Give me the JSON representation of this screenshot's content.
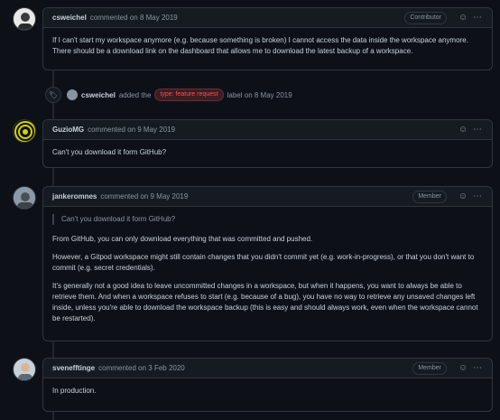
{
  "comments": [
    {
      "author": "csweichel",
      "meta": "commented on 8 May 2019",
      "badge": "Contributor",
      "paragraphs": [
        "If I can't start my workspace anymore (e.g. because something is broken) I cannot access the data inside the workspace anymore. There should be a download link on the dashboard that allows me to download the latest backup of a workspace."
      ]
    },
    {
      "author": "GuzioMG",
      "meta": "commented on 9 May 2019",
      "badge": "",
      "paragraphs": [
        "Can't you download it form GitHub?"
      ]
    },
    {
      "author": "jankeromnes",
      "meta": "commented on 9 May 2019",
      "badge": "Member",
      "quote": "Can't you download it form GitHub?",
      "paragraphs": [
        "From GitHub, you can only download everything that was committed and pushed.",
        "However, a Gitpod workspace might still contain changes that you didn't commit yet (e.g. work-in-progress), or that you don't want to commit (e.g. secret credentials).",
        "It's generally not a good idea to leave uncommitted changes in a workspace, but when it happens, you want to always be able to retrieve them. And when a workspace refuses to start (e.g. because of a bug), you have no way to retrieve any unsaved changes left inside, unless you're able to download the workspace backup (this is easy and should always work, even when the workspace cannot be restarted)."
      ]
    },
    {
      "author": "svenefftinge",
      "meta": "commented on 3 Feb 2020",
      "badge": "Member",
      "paragraphs": [
        "In production."
      ]
    }
  ],
  "event": {
    "actor": "csweichel",
    "action": "added the",
    "label": "type: feature request",
    "suffix": "label on 8 May 2019"
  },
  "icons": {
    "reaction": "smiley-icon",
    "menu": "kebab-menu-icon",
    "event": "tag-icon"
  },
  "colors": {
    "background": "#0d1117",
    "header": "#161b22",
    "border": "#30363d",
    "label": "#f85149"
  }
}
